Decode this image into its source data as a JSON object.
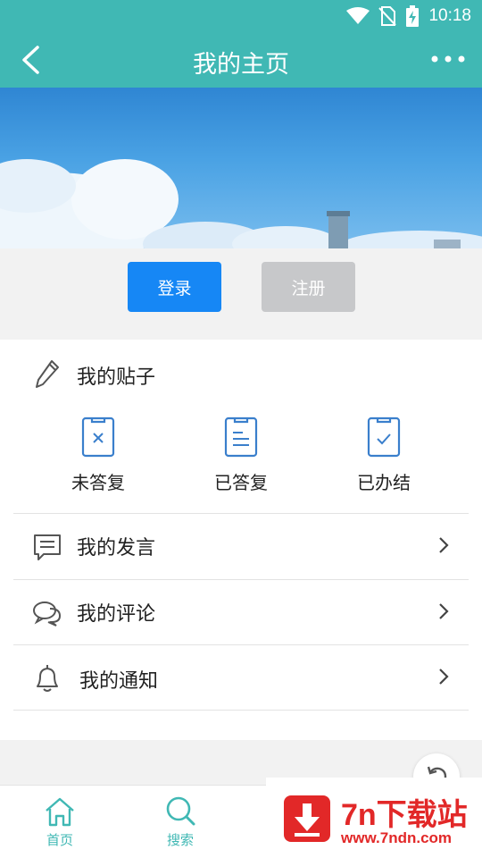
{
  "status_bar": {
    "time": "10:18"
  },
  "app_bar": {
    "title": "我的主页"
  },
  "auth": {
    "login_label": "登录",
    "register_label": "注册"
  },
  "posts": {
    "label": "我的贴子",
    "statuses": [
      {
        "label": "未答复",
        "icon": "clipboard-x-icon"
      },
      {
        "label": "已答复",
        "icon": "clipboard-lines-icon"
      },
      {
        "label": "已办结",
        "icon": "clipboard-check-icon"
      }
    ]
  },
  "menu": {
    "items": [
      {
        "label": "我的发言",
        "icon": "message-icon"
      },
      {
        "label": "我的评论",
        "icon": "comments-icon"
      },
      {
        "label": "我的通知",
        "icon": "bell-icon"
      }
    ]
  },
  "tabs": [
    {
      "label": "首页",
      "icon": "home-icon"
    },
    {
      "label": "搜索",
      "icon": "search-icon"
    }
  ],
  "watermark": {
    "title": "7n下载站",
    "url": "www.7ndn.com"
  },
  "colors": {
    "accent": "#40b8b4",
    "login": "#1687f5",
    "register": "#c7c8ca",
    "watermark": "#e22828"
  }
}
